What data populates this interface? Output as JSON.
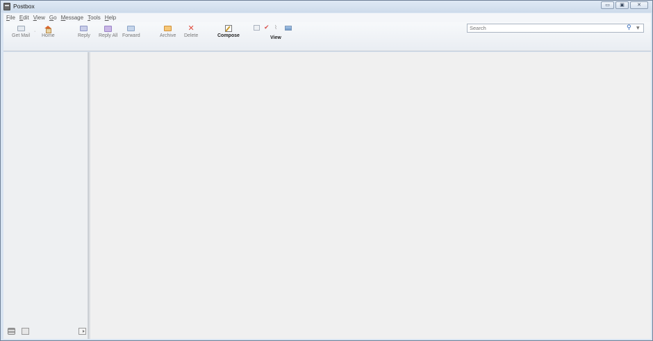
{
  "window": {
    "title": "Postbox",
    "controls": {
      "minimize": "▭",
      "maximize": "▣",
      "close": "✕"
    }
  },
  "menu": {
    "items": [
      {
        "accel": "F",
        "rest": "ile"
      },
      {
        "accel": "E",
        "rest": "dit"
      },
      {
        "accel": "V",
        "rest": "iew"
      },
      {
        "accel": "G",
        "rest": "o"
      },
      {
        "accel": "M",
        "rest": "essage"
      },
      {
        "accel": "T",
        "rest": "ools"
      },
      {
        "accel": "H",
        "rest": "elp"
      }
    ]
  },
  "toolbar": {
    "get_mail": "Get Mail",
    "home": "Home",
    "reply": "Reply",
    "reply_all": "Reply All",
    "forward": "Forward",
    "archive": "Archive",
    "delete": "Delete",
    "compose": "Compose",
    "view": "View",
    "view_icons": {
      "mail": "",
      "flag": "✔",
      "attachment": "⌇",
      "picture": ""
    },
    "delete_glyph": "✕",
    "dropdown_glyph": "·"
  },
  "search": {
    "placeholder": "Search",
    "search_glyph": "⚲",
    "dropdown_glyph": "▼"
  },
  "colors": {
    "accent": "#2a63b8",
    "delete_red": "#e04a3b",
    "home_orange": "#d9662d"
  }
}
